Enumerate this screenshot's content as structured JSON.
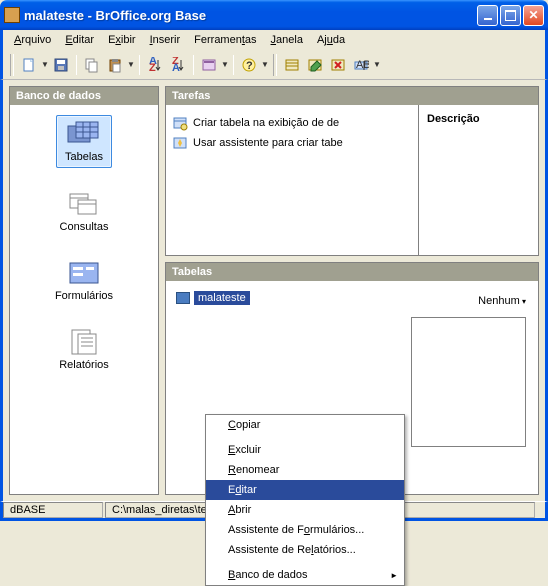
{
  "title": "malateste - BrOffice.org Base",
  "menu": {
    "arquivo": "Arquivo",
    "editar": "Editar",
    "exibir": "Exibir",
    "inserir": "Inserir",
    "ferramentas": "Ferramentas",
    "janela": "Janela",
    "ajuda": "Ajuda"
  },
  "sidebar": {
    "header": "Banco de dados",
    "items": [
      {
        "label": "Tabelas"
      },
      {
        "label": "Consultas"
      },
      {
        "label": "Formulários"
      },
      {
        "label": "Relatórios"
      }
    ]
  },
  "tasks": {
    "header": "Tarefas",
    "items": [
      {
        "label": "Criar tabela na exibição de de"
      },
      {
        "label": "Usar assistente para criar tabe"
      }
    ],
    "desc_header": "Descrição"
  },
  "tables": {
    "header": "Tabelas",
    "item": "malateste",
    "none": "Nenhum"
  },
  "context": {
    "copiar": "Copiar",
    "excluir": "Excluir",
    "renomear": "Renomear",
    "editar": "Editar",
    "abrir": "Abrir",
    "asst_form": "Assistente de Formulários...",
    "asst_rel": "Assistente de Relatórios...",
    "banco": "Banco de dados"
  },
  "status": {
    "dbtype": "dBASE",
    "path": "C:\\malas_diretas\\teste"
  }
}
